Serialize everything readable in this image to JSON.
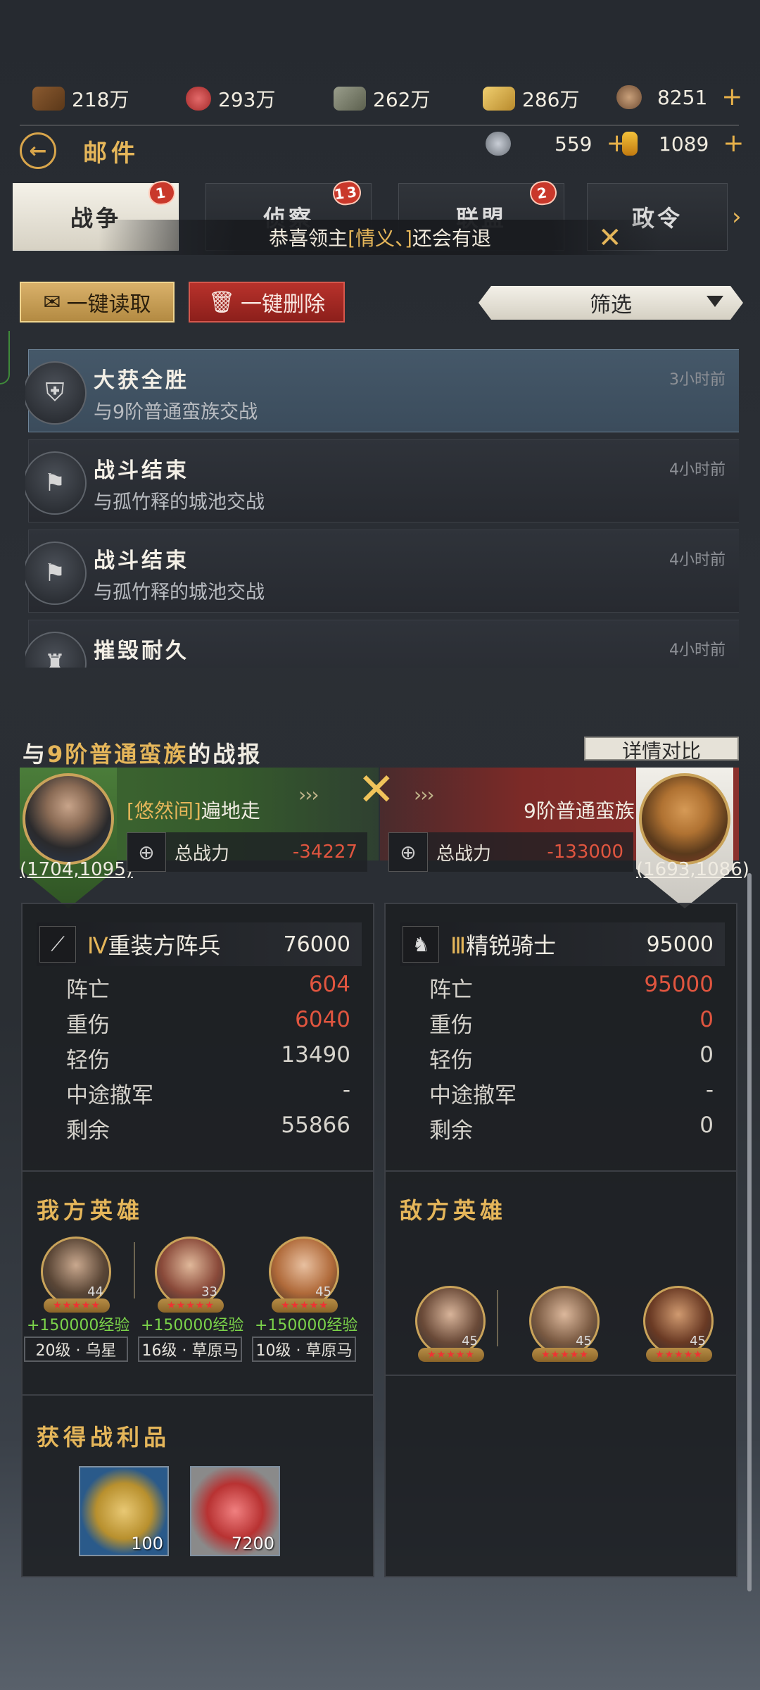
{
  "resources": [
    {
      "icon": "wood-icon",
      "value": "218万"
    },
    {
      "icon": "meat-icon",
      "value": "293万"
    },
    {
      "icon": "stone-icon",
      "value": "262万"
    },
    {
      "icon": "gold-bar-icon",
      "value": "286万"
    },
    {
      "icon": "coin-icon",
      "value": "8251"
    }
  ],
  "currency": [
    {
      "icon": "silver-token-icon",
      "value": "559"
    },
    {
      "icon": "gold-feather-icon",
      "value": "1089"
    }
  ],
  "header": {
    "title": "邮件"
  },
  "tabs": [
    {
      "label": "战争",
      "badge": "1",
      "active": true
    },
    {
      "label": "侦察",
      "badge": "13"
    },
    {
      "label": "联盟",
      "badge": "2"
    },
    {
      "label": "政令"
    }
  ],
  "toast": {
    "prefix": "恭喜领主",
    "highlight": "[情义、]",
    "suffix": "还会有退"
  },
  "actions": {
    "read_all": "一键读取",
    "delete_all": "一键删除",
    "filter": "筛选"
  },
  "mails": [
    {
      "title": "大获全胜",
      "subtitle": "与9阶普通蛮族交战",
      "time": "3小时前"
    },
    {
      "title": "战斗结束",
      "subtitle": "与孤竹释的城池交战",
      "time": "4小时前"
    },
    {
      "title": "战斗结束",
      "subtitle": "与孤竹释的城池交战",
      "time": "4小时前"
    },
    {
      "title": "摧毁耐久",
      "subtitle": "",
      "time": "4小时前"
    }
  ],
  "report": {
    "title_prefix": "与",
    "title_highlight": "9阶普通蛮族",
    "title_suffix": "的战报",
    "detail_button": "详情对比",
    "me": {
      "guild": "[悠然间]",
      "name": "遍地走",
      "coord": "(1704,1095)",
      "power_label": "总战力",
      "power": "-34227"
    },
    "enemy": {
      "name": "9阶普通蛮族",
      "coord": "(1693,1086)",
      "power_label": "总战力",
      "power": "-133000"
    },
    "my_unit": {
      "tier": "Ⅳ",
      "name": "重装方阵兵",
      "count": "76000",
      "stats": [
        {
          "label": "阵亡",
          "value": "604"
        },
        {
          "label": "重伤",
          "value": "6040"
        },
        {
          "label": "轻伤",
          "value": "13490"
        },
        {
          "label": "中途撤军",
          "value": "-"
        },
        {
          "label": "剩余",
          "value": "55866"
        }
      ]
    },
    "enemy_unit": {
      "tier": "Ⅲ",
      "name": "精锐骑士",
      "count": "95000",
      "stats": [
        {
          "label": "阵亡",
          "value": "95000"
        },
        {
          "label": "重伤",
          "value": "0"
        },
        {
          "label": "轻伤",
          "value": "0"
        },
        {
          "label": "中途撤军",
          "value": "-"
        },
        {
          "label": "剩余",
          "value": "0"
        }
      ]
    },
    "my_heroes_title": "我方英雄",
    "enemy_heroes_title": "敌方英雄",
    "my_heroes": [
      {
        "level": "44",
        "xp": "+150000经验",
        "soldier": "20级 · 乌星"
      },
      {
        "level": "33",
        "xp": "+150000经验",
        "soldier": "16级 · 草原马"
      },
      {
        "level": "45",
        "xp": "+150000经验",
        "soldier": "10级 · 草原马"
      }
    ],
    "enemy_heroes": [
      {
        "level": "45"
      },
      {
        "level": "45"
      },
      {
        "level": "45"
      }
    ],
    "loot_title": "获得战利品",
    "loot": [
      {
        "icon": "gold-medal-icon",
        "qty": "100"
      },
      {
        "icon": "meat-icon",
        "qty": "7200"
      }
    ]
  },
  "colors": {
    "accent": "#e5b65a",
    "danger": "#e0553f",
    "xp": "#7bd34a"
  }
}
